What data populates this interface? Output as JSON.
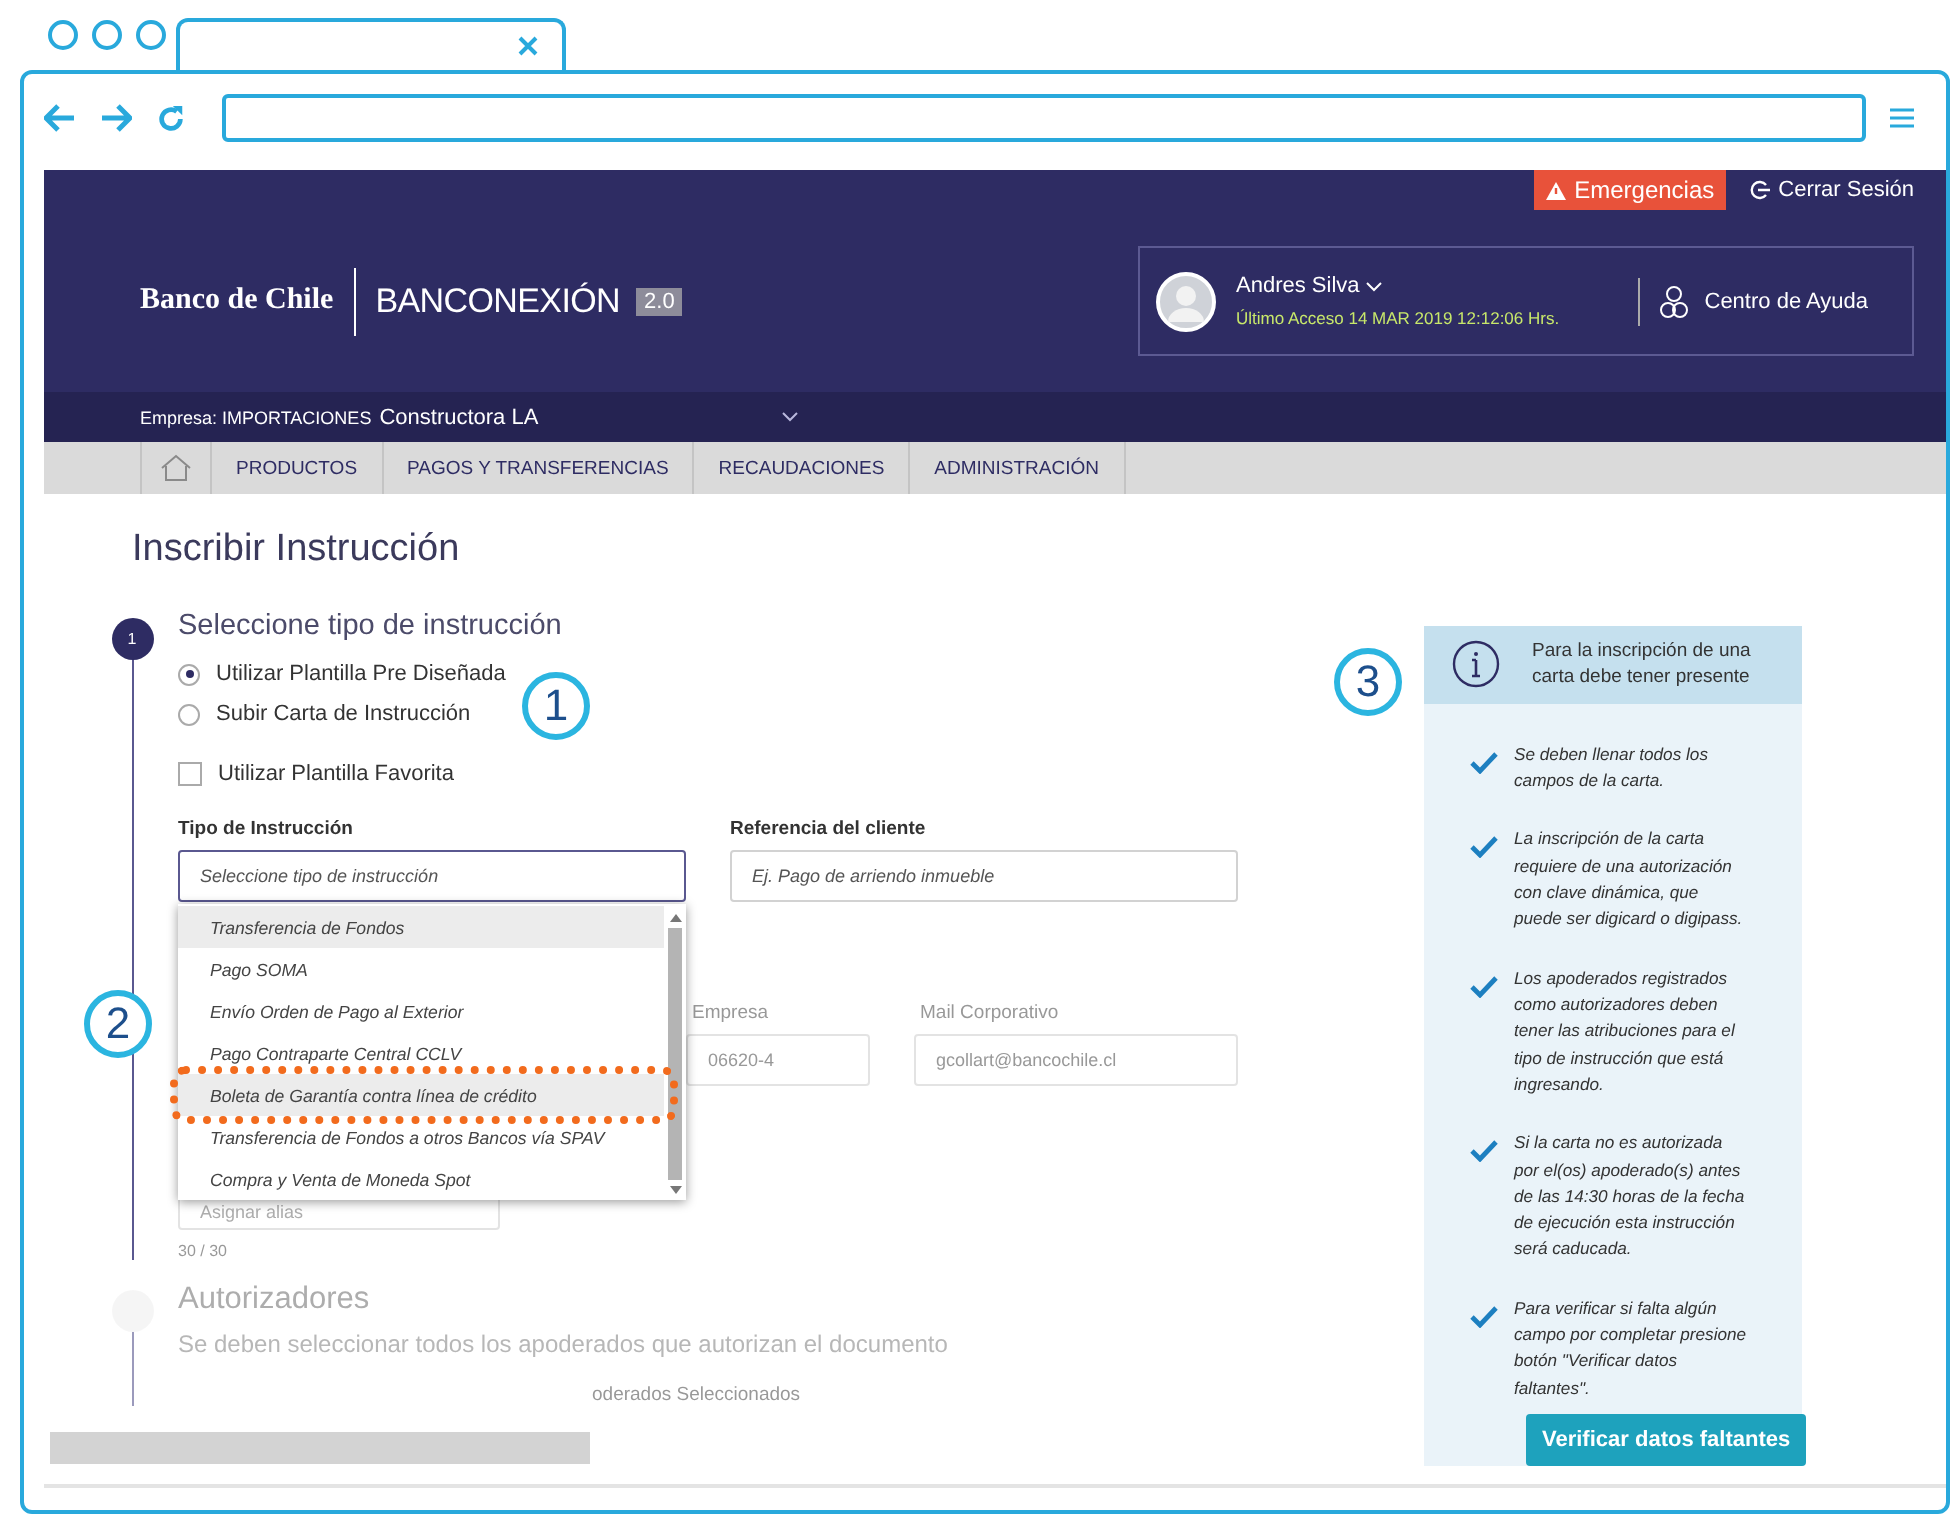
{
  "header": {
    "bank": "Banco de Chile",
    "product": "BANCONEXIÓN",
    "version": "2.0",
    "emergency": "Emergencias",
    "logout": "Cerrar Sesión",
    "user": {
      "name": "Andres Silva",
      "last_access": "Último Acceso 14 MAR 2019 12:12:06 Hrs."
    },
    "help": "Centro de Ayuda"
  },
  "company": {
    "label": "Empresa:",
    "group": "IMPORTACIONES",
    "name": "Constructora LA"
  },
  "nav": {
    "items": [
      {
        "label": "PRODUCTOS"
      },
      {
        "label": "PAGOS Y TRANSFERENCIAS"
      },
      {
        "label": "RECAUDACIONES"
      },
      {
        "label": "ADMINISTRACIÓN"
      }
    ]
  },
  "page": {
    "title": "Inscribir Instrucción"
  },
  "step1": {
    "number": "1",
    "title": "Seleccione tipo de instrucción",
    "radios": [
      {
        "label": "Utilizar Plantilla Pre Diseñada",
        "selected": true
      },
      {
        "label": "Subir Carta de Instrucción",
        "selected": false
      }
    ],
    "checkbox": {
      "label": "Utilizar Plantilla Favorita",
      "checked": false
    },
    "type_field": {
      "label": "Tipo de Instrucción",
      "placeholder": "Seleccione tipo de instrucción"
    },
    "reference_field": {
      "label": "Referencia del cliente",
      "placeholder": "Ej. Pago de arriendo inmueble"
    },
    "dropdown": [
      {
        "label": "Transferencia de Fondos",
        "highlighted": true,
        "callout": false
      },
      {
        "label": "Pago SOMA",
        "highlighted": false,
        "callout": false
      },
      {
        "label": "Envío Orden de Pago al Exterior",
        "highlighted": false,
        "callout": false
      },
      {
        "label": "Pago Contraparte Central CCLV",
        "highlighted": false,
        "callout": false
      },
      {
        "label": "Boleta de Garantía contra línea de crédito",
        "highlighted": true,
        "callout": true
      },
      {
        "label": "Transferencia de Fondos a otros Bancos vía SPAV",
        "highlighted": false,
        "callout": false
      },
      {
        "label": "Compra y Venta de Moneda Spot",
        "highlighted": false,
        "callout": false
      }
    ],
    "company_field": {
      "label": "Empresa",
      "value": "06620-4"
    },
    "mail_field": {
      "label": "Mail Corporativo",
      "value": "gcollart@bancochile.cl"
    },
    "alias_field": {
      "placeholder": "Asignar alias",
      "counter": "30 / 30"
    }
  },
  "step2": {
    "title": "Autorizadores",
    "description": "Se deben seleccionar todos los apoderados que autorizan el documento",
    "column_2": "oderados Seleccionados"
  },
  "info_panel": {
    "title": "Para la inscripción de una carta debe tener presente",
    "items": [
      "Se deben llenar todos los campos de la carta.",
      "La inscripción de la carta requiere de una autorización con clave dinámica, que puede ser digicard o digipass.",
      "Los apoderados registrados como autorizadores deben tener las atribuciones para el tipo de instrucción que está ingresando.",
      "Si la carta no es autorizada por el(os) apoderado(s) antes de las 14:30 horas de la fecha de ejecución esta instrucción será caducada.",
      "Para verificar si falta algún campo por completar presione botón \"Verificar datos faltantes\"."
    ],
    "button": "Verificar datos faltantes"
  },
  "annotations": [
    "1",
    "2",
    "3"
  ]
}
